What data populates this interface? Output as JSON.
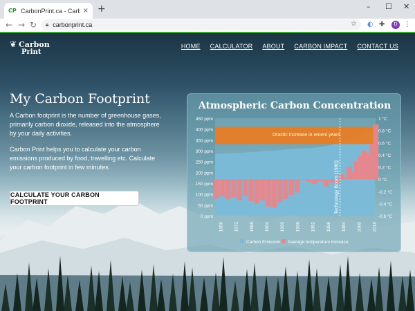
{
  "browser": {
    "tab_title": "CarbonPrint.ca - Carbon footprint",
    "tab_close": "×",
    "new_tab": "+",
    "url": "carbonprint.ca",
    "avatar_letter": "D",
    "controls": {
      "minimize": "–",
      "maximize": "☐",
      "close": "✕"
    },
    "nav": {
      "back": "←",
      "forward": "→",
      "reload": "↻"
    },
    "icons": [
      "lock-icon",
      "star-icon",
      "extension-icon",
      "puzzle-icon",
      "menu-icon"
    ]
  },
  "site": {
    "logo": {
      "line1": "Carbon",
      "line2": "Print"
    },
    "nav_links": [
      "HOME",
      "CALCULATOR",
      "ABOUT",
      "CARBON IMPACT",
      "CONTACT US"
    ]
  },
  "hero": {
    "title": "My Carbon Footprint",
    "para1": "A Carbon footprint is the number of greenhouse gases, primarily carbon dioxide, released into the atmosphere by your daily activities.",
    "para2": "Carbon Print helps you to calculate your carbon emissions produced by food, travelling etc. Calculate your carbon footprint in few minutes.",
    "cta": "CALCULATE YOUR CARBON FOOTPRINT"
  },
  "colors": {
    "accent_green": "#3fa53a",
    "co2_area": "#7bbad8",
    "temp_bars": "#e8868c",
    "highlight_band": "#f07a1a"
  },
  "chart_data": {
    "type": "area",
    "title": "Atmospheric Carbon Concentration",
    "y_left": {
      "ticks": [
        "0 ppm",
        "50 ppm",
        "100 ppm",
        "150 ppm",
        "200 ppm",
        "250 ppm",
        "300 ppm",
        "350 ppm",
        "400 ppm",
        "450 ppm"
      ],
      "range": [
        0,
        450
      ]
    },
    "y_right": {
      "ticks": [
        "-0.6 °C",
        "-0.4 °C",
        "-0.2 °C",
        "0 °C",
        "0.2 °C",
        "0.4 °C",
        "0.6 °C",
        "0.8 °C",
        "1 °C"
      ],
      "range": [
        -0.6,
        1.0
      ]
    },
    "x_ticks": [
      "1856",
      "1872",
      "1888",
      "1904",
      "1920",
      "1936",
      "1952",
      "1968",
      "1984",
      "2000",
      "2016"
    ],
    "x_range": [
      1850,
      2017
    ],
    "band": {
      "label": "Drastic increase in recent years",
      "y_range": [
        330,
        410
      ]
    },
    "annotation": {
      "label": "Technology Boom (1980)",
      "x": 1980
    },
    "series": [
      {
        "name": "Carbon Emission",
        "x": [
          1850,
          1870,
          1890,
          1910,
          1930,
          1950,
          1960,
          1970,
          1980,
          1990,
          2000,
          2010,
          2016
        ],
        "values": [
          285,
          288,
          294,
          300,
          307,
          312,
          317,
          325,
          338,
          354,
          369,
          389,
          404
        ]
      },
      {
        "name": "Average temperature increase",
        "x": [
          1850,
          1856,
          1862,
          1868,
          1874,
          1880,
          1886,
          1892,
          1898,
          1904,
          1910,
          1916,
          1922,
          1928,
          1934,
          1940,
          1946,
          1952,
          1958,
          1964,
          1970,
          1976,
          1980,
          1984,
          1988,
          1992,
          1996,
          2000,
          2004,
          2008,
          2012,
          2016
        ],
        "values": [
          -0.32,
          -0.28,
          -0.33,
          -0.3,
          -0.35,
          -0.28,
          -0.36,
          -0.4,
          -0.35,
          -0.45,
          -0.47,
          -0.38,
          -0.33,
          -0.26,
          -0.22,
          -0.02,
          -0.05,
          -0.08,
          -0.04,
          -0.12,
          -0.06,
          -0.08,
          0.08,
          0.03,
          0.2,
          0.12,
          0.3,
          0.38,
          0.47,
          0.42,
          0.58,
          0.9
        ]
      }
    ]
  }
}
